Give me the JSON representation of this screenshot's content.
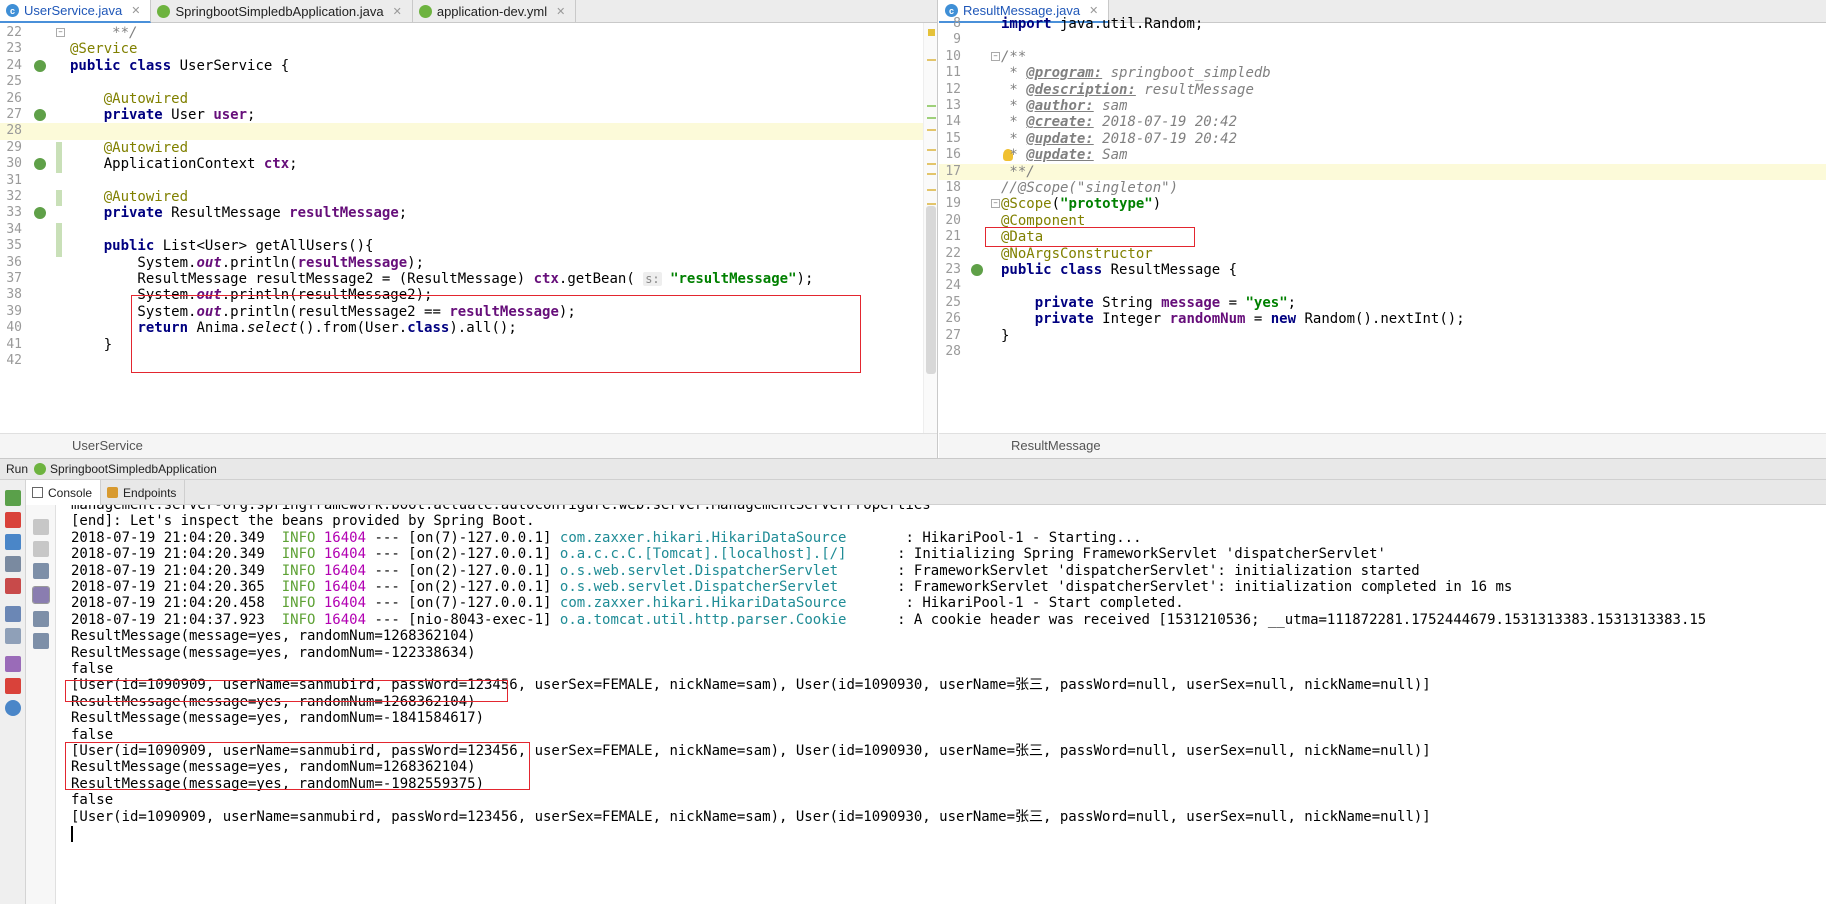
{
  "editor_left": {
    "tabs": [
      {
        "label": "UserService.java",
        "icon": "class-icon",
        "active": true
      },
      {
        "label": "SpringbootSimpledbApplication.java",
        "icon": "spring-icon",
        "active": false
      },
      {
        "label": "application-dev.yml",
        "icon": "yml-icon",
        "active": false
      }
    ],
    "breadcrumb": "UserService",
    "lines": [
      {
        "n": "22",
        "segs": [
          {
            "t": "     **/",
            "c": "cmt"
          }
        ]
      },
      {
        "n": "23",
        "segs": [
          {
            "t": "@Service",
            "c": "ann"
          }
        ]
      },
      {
        "n": "24",
        "segs": [
          {
            "t": "public",
            "c": "kw"
          },
          {
            "t": " ",
            "c": ""
          },
          {
            "t": "class",
            "c": "kw"
          },
          {
            "t": " UserService {",
            "c": ""
          }
        ]
      },
      {
        "n": "25",
        "segs": []
      },
      {
        "n": "26",
        "segs": [
          {
            "t": "    ",
            "c": ""
          },
          {
            "t": "@Autowired",
            "c": "ann"
          }
        ]
      },
      {
        "n": "27",
        "segs": [
          {
            "t": "    ",
            "c": ""
          },
          {
            "t": "private",
            "c": "kw"
          },
          {
            "t": " User ",
            "c": ""
          },
          {
            "t": "user",
            "c": "field"
          },
          {
            "t": ";",
            "c": ""
          }
        ]
      },
      {
        "n": "28",
        "segs": []
      },
      {
        "n": "29",
        "segs": [
          {
            "t": "    ",
            "c": ""
          },
          {
            "t": "@Autowired",
            "c": "ann"
          }
        ]
      },
      {
        "n": "30",
        "segs": [
          {
            "t": "    ApplicationContext ",
            "c": ""
          },
          {
            "t": "ctx",
            "c": "field"
          },
          {
            "t": ";",
            "c": ""
          }
        ]
      },
      {
        "n": "31",
        "segs": []
      },
      {
        "n": "32",
        "segs": [
          {
            "t": "    ",
            "c": ""
          },
          {
            "t": "@Autowired",
            "c": "ann"
          }
        ]
      },
      {
        "n": "33",
        "segs": [
          {
            "t": "    ",
            "c": ""
          },
          {
            "t": "private",
            "c": "kw"
          },
          {
            "t": " ResultMessage ",
            "c": ""
          },
          {
            "t": "resultMessage",
            "c": "field"
          },
          {
            "t": ";",
            "c": ""
          }
        ]
      },
      {
        "n": "34",
        "segs": []
      },
      {
        "n": "35",
        "segs": [
          {
            "t": "    ",
            "c": ""
          },
          {
            "t": "public",
            "c": "kw"
          },
          {
            "t": " List<User> getAllUsers(){",
            "c": ""
          }
        ]
      },
      {
        "n": "36",
        "segs": [
          {
            "t": "        System.",
            "c": ""
          },
          {
            "t": "out",
            "c": "static"
          },
          {
            "t": ".println(",
            "c": ""
          },
          {
            "t": "resultMessage",
            "c": "field"
          },
          {
            "t": ");",
            "c": ""
          }
        ]
      },
      {
        "n": "37",
        "segs": [
          {
            "t": "        ResultMessage resultMessage2 = (ResultMessage) ",
            "c": ""
          },
          {
            "t": "ctx",
            "c": "field"
          },
          {
            "t": ".getBean( ",
            "c": ""
          },
          {
            "t": "s:",
            "c": "hint"
          },
          {
            "t": " ",
            "c": ""
          },
          {
            "t": "\"resultMessage\"",
            "c": "str"
          },
          {
            "t": ");",
            "c": ""
          }
        ]
      },
      {
        "n": "38",
        "segs": [
          {
            "t": "        System.",
            "c": ""
          },
          {
            "t": "out",
            "c": "static"
          },
          {
            "t": ".println(resultMessage2);",
            "c": ""
          }
        ]
      },
      {
        "n": "39",
        "segs": [
          {
            "t": "        System.",
            "c": ""
          },
          {
            "t": "out",
            "c": "static"
          },
          {
            "t": ".println(resultMessage2 == ",
            "c": ""
          },
          {
            "t": "resultMessage",
            "c": "field"
          },
          {
            "t": ");",
            "c": ""
          }
        ]
      },
      {
        "n": "40",
        "segs": [
          {
            "t": "        ",
            "c": ""
          },
          {
            "t": "return",
            "c": "kw"
          },
          {
            "t": " Anima.",
            "c": ""
          },
          {
            "t": "select",
            "c": "italic"
          },
          {
            "t": "().from(User.",
            "c": ""
          },
          {
            "t": "class",
            "c": "kw"
          },
          {
            "t": ").all();",
            "c": ""
          }
        ]
      },
      {
        "n": "41",
        "segs": [
          {
            "t": "    }",
            "c": ""
          }
        ]
      },
      {
        "n": "42",
        "segs": []
      }
    ]
  },
  "editor_right": {
    "tabs": [
      {
        "label": "ResultMessage.java",
        "icon": "class-icon",
        "active": true
      }
    ],
    "breadcrumb": "ResultMessage",
    "lines": [
      {
        "n": "8",
        "segs": [
          {
            "t": "import",
            "c": "kw"
          },
          {
            "t": " java.util.Random;",
            "c": ""
          }
        ]
      },
      {
        "n": "9",
        "segs": []
      },
      {
        "n": "10",
        "segs": [
          {
            "t": "/**",
            "c": "cmt"
          }
        ]
      },
      {
        "n": "11",
        "segs": [
          {
            "t": " * ",
            "c": "cmt"
          },
          {
            "t": "@program:",
            "c": "jdtag"
          },
          {
            "t": " springboot_simpledb",
            "c": "jdval"
          }
        ]
      },
      {
        "n": "12",
        "segs": [
          {
            "t": " * ",
            "c": "cmt"
          },
          {
            "t": "@description:",
            "c": "jdtag"
          },
          {
            "t": " resultMessage",
            "c": "jdval"
          }
        ]
      },
      {
        "n": "13",
        "segs": [
          {
            "t": " * ",
            "c": "cmt"
          },
          {
            "t": "@author:",
            "c": "jdtag"
          },
          {
            "t": " sam",
            "c": "jdval"
          }
        ]
      },
      {
        "n": "14",
        "segs": [
          {
            "t": " * ",
            "c": "cmt"
          },
          {
            "t": "@create:",
            "c": "jdtag"
          },
          {
            "t": " 2018-07-19 20:42",
            "c": "jdval"
          }
        ]
      },
      {
        "n": "15",
        "segs": [
          {
            "t": " * ",
            "c": "cmt"
          },
          {
            "t": "@update:",
            "c": "jdtag"
          },
          {
            "t": " 2018-07-19 20:42",
            "c": "jdval"
          }
        ]
      },
      {
        "n": "16",
        "segs": [
          {
            "t": " * ",
            "c": "cmt"
          },
          {
            "t": "@update:",
            "c": "jdtag"
          },
          {
            "t": " Sam",
            "c": "jdval"
          }
        ]
      },
      {
        "n": "17",
        "segs": [
          {
            "t": " **/",
            "c": "cmt"
          }
        ]
      },
      {
        "n": "18",
        "segs": [
          {
            "t": "//@Scope(\"singleton\")",
            "c": "cmt"
          }
        ]
      },
      {
        "n": "19",
        "segs": [
          {
            "t": "@Scope",
            "c": "ann"
          },
          {
            "t": "(",
            "c": ""
          },
          {
            "t": "\"prototype\"",
            "c": "str"
          },
          {
            "t": ")",
            "c": ""
          }
        ]
      },
      {
        "n": "20",
        "segs": [
          {
            "t": "@Component",
            "c": "ann"
          }
        ]
      },
      {
        "n": "21",
        "segs": [
          {
            "t": "@Data",
            "c": "ann"
          }
        ]
      },
      {
        "n": "22",
        "segs": [
          {
            "t": "@NoArgsConstructor",
            "c": "ann"
          }
        ]
      },
      {
        "n": "23",
        "segs": [
          {
            "t": "public",
            "c": "kw"
          },
          {
            "t": " ",
            "c": ""
          },
          {
            "t": "class",
            "c": "kw"
          },
          {
            "t": " ResultMessage {",
            "c": ""
          }
        ]
      },
      {
        "n": "24",
        "segs": []
      },
      {
        "n": "25",
        "segs": [
          {
            "t": "    ",
            "c": ""
          },
          {
            "t": "private",
            "c": "kw"
          },
          {
            "t": " String ",
            "c": ""
          },
          {
            "t": "message",
            "c": "field"
          },
          {
            "t": " = ",
            "c": ""
          },
          {
            "t": "\"yes\"",
            "c": "str"
          },
          {
            "t": ";",
            "c": ""
          }
        ]
      },
      {
        "n": "26",
        "segs": [
          {
            "t": "    ",
            "c": ""
          },
          {
            "t": "private",
            "c": "kw"
          },
          {
            "t": " Integer ",
            "c": ""
          },
          {
            "t": "randomNum",
            "c": "field"
          },
          {
            "t": " = ",
            "c": ""
          },
          {
            "t": "new",
            "c": "kw"
          },
          {
            "t": " Random().nextInt();",
            "c": ""
          }
        ]
      },
      {
        "n": "27",
        "segs": [
          {
            "t": "}",
            "c": ""
          }
        ]
      },
      {
        "n": "28",
        "segs": []
      }
    ]
  },
  "run": {
    "label": "Run",
    "config_name": "SpringbootSimpledbApplication",
    "tabs": [
      {
        "label": "Console",
        "active": true
      },
      {
        "label": "Endpoints",
        "active": false
      }
    ]
  },
  "console": {
    "lines": [
      [
        {
          "t": "management.server-org.springframework.boot.actuate.autoconfigure.web.server.ManagementServerProperties",
          "c": ""
        }
      ],
      [
        {
          "t": "[end]: Let's inspect the beans provided by Spring Boot.",
          "c": ""
        }
      ],
      [
        {
          "t": "2018-07-19 21:04:20.349  ",
          "c": ""
        },
        {
          "t": "INFO",
          "c": "c-info"
        },
        {
          "t": " ",
          "c": ""
        },
        {
          "t": "16404",
          "c": "c-pid"
        },
        {
          "t": " --- [on(7)-127.0.0.1] ",
          "c": ""
        },
        {
          "t": "com.zaxxer.hikari.HikariDataSource      ",
          "c": "c-logger"
        },
        {
          "t": " : HikariPool-1 - Starting...",
          "c": ""
        }
      ],
      [
        {
          "t": "2018-07-19 21:04:20.349  ",
          "c": ""
        },
        {
          "t": "INFO",
          "c": "c-info"
        },
        {
          "t": " ",
          "c": ""
        },
        {
          "t": "16404",
          "c": "c-pid"
        },
        {
          "t": " --- [on(2)-127.0.0.1] ",
          "c": ""
        },
        {
          "t": "o.a.c.c.C.[Tomcat].[localhost].[/]     ",
          "c": "c-logger"
        },
        {
          "t": " : Initializing Spring FrameworkServlet 'dispatcherServlet'",
          "c": ""
        }
      ],
      [
        {
          "t": "2018-07-19 21:04:20.349  ",
          "c": ""
        },
        {
          "t": "INFO",
          "c": "c-info"
        },
        {
          "t": " ",
          "c": ""
        },
        {
          "t": "16404",
          "c": "c-pid"
        },
        {
          "t": " --- [on(2)-127.0.0.1] ",
          "c": ""
        },
        {
          "t": "o.s.web.servlet.DispatcherServlet      ",
          "c": "c-logger"
        },
        {
          "t": " : FrameworkServlet 'dispatcherServlet': initialization started",
          "c": ""
        }
      ],
      [
        {
          "t": "2018-07-19 21:04:20.365  ",
          "c": ""
        },
        {
          "t": "INFO",
          "c": "c-info"
        },
        {
          "t": " ",
          "c": ""
        },
        {
          "t": "16404",
          "c": "c-pid"
        },
        {
          "t": " --- [on(2)-127.0.0.1] ",
          "c": ""
        },
        {
          "t": "o.s.web.servlet.DispatcherServlet      ",
          "c": "c-logger"
        },
        {
          "t": " : FrameworkServlet 'dispatcherServlet': initialization completed in 16 ms",
          "c": ""
        }
      ],
      [
        {
          "t": "2018-07-19 21:04:20.458  ",
          "c": ""
        },
        {
          "t": "INFO",
          "c": "c-info"
        },
        {
          "t": " ",
          "c": ""
        },
        {
          "t": "16404",
          "c": "c-pid"
        },
        {
          "t": " --- [on(7)-127.0.0.1] ",
          "c": ""
        },
        {
          "t": "com.zaxxer.hikari.HikariDataSource      ",
          "c": "c-logger"
        },
        {
          "t": " : HikariPool-1 - Start completed.",
          "c": ""
        }
      ],
      [
        {
          "t": "2018-07-19 21:04:37.923  ",
          "c": ""
        },
        {
          "t": "INFO",
          "c": "c-info"
        },
        {
          "t": " ",
          "c": ""
        },
        {
          "t": "16404",
          "c": "c-pid"
        },
        {
          "t": " --- [nio-8043-exec-1] ",
          "c": ""
        },
        {
          "t": "o.a.tomcat.util.http.parser.Cookie     ",
          "c": "c-logger"
        },
        {
          "t": " : A cookie header was received [1531210536; __utma=111872281.1752444679.1531313383.1531313383.15",
          "c": ""
        }
      ],
      [
        {
          "t": "ResultMessage(message=yes, randomNum=1268362104)",
          "c": ""
        }
      ],
      [
        {
          "t": "ResultMessage(message=yes, randomNum=-122338634)",
          "c": ""
        }
      ],
      [
        {
          "t": "false",
          "c": ""
        }
      ],
      [
        {
          "t": "[User(id=1090909, userName=sanmubird, passWord=123456, userSex=FEMALE, nickName=sam), User(id=1090930, userName=张三, passWord=null, userSex=null, nickName=null)]",
          "c": ""
        }
      ],
      [
        {
          "t": "ResultMessage(message=yes, randomNum=1268362104)",
          "c": ""
        }
      ],
      [
        {
          "t": "ResultMessage(message=yes, randomNum=-1841584617)",
          "c": ""
        }
      ],
      [
        {
          "t": "false",
          "c": ""
        }
      ],
      [
        {
          "t": "[User(id=1090909, userName=sanmubird, passWord=123456, userSex=FEMALE, nickName=sam), User(id=1090930, userName=张三, passWord=null, userSex=null, nickName=null)]",
          "c": ""
        }
      ],
      [
        {
          "t": "ResultMessage(message=yes, randomNum=1268362104)",
          "c": ""
        }
      ],
      [
        {
          "t": "ResultMessage(message=yes, randomNum=-1982559375)",
          "c": ""
        }
      ],
      [
        {
          "t": "false",
          "c": ""
        }
      ],
      [
        {
          "t": "[User(id=1090909, userName=sanmubird, passWord=123456, userSex=FEMALE, nickName=sam), User(id=1090930, userName=张三, passWord=null, userSex=null, nickName=null)]",
          "c": ""
        }
      ]
    ]
  }
}
